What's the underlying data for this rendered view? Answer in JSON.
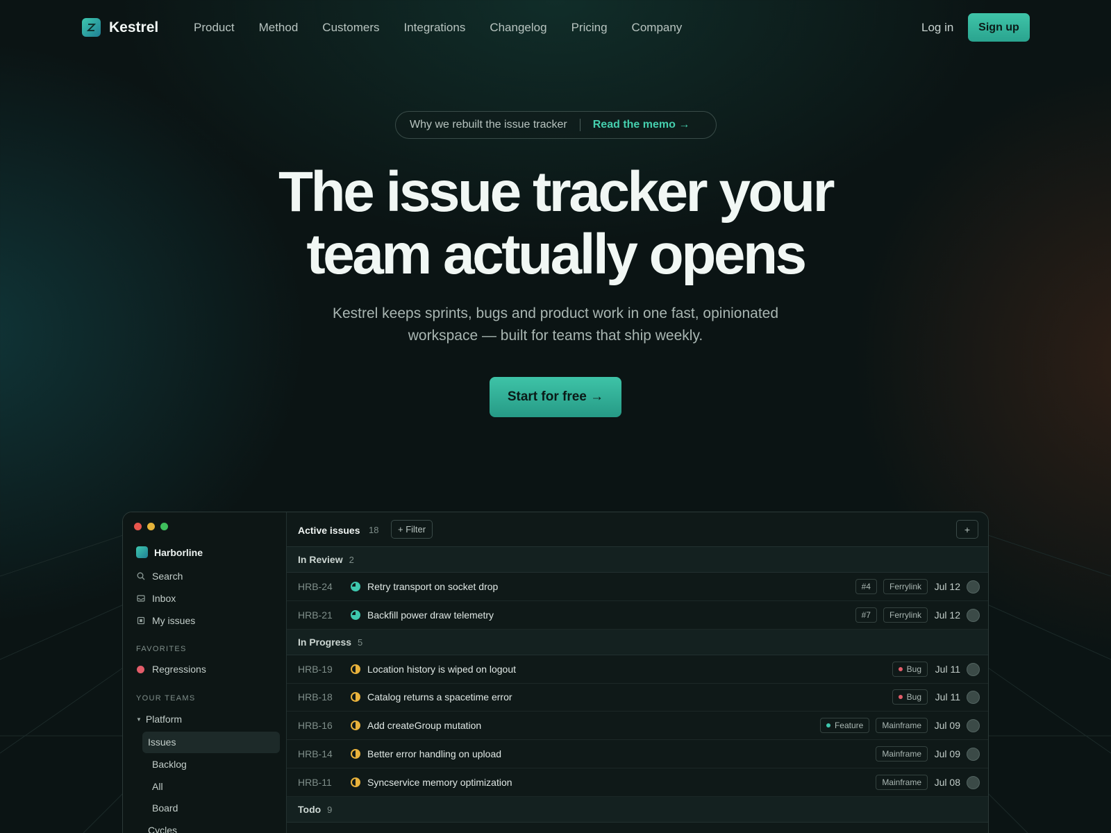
{
  "nav": {
    "brand": "Kestrel",
    "links": [
      "Product",
      "Method",
      "Customers",
      "Integrations",
      "Changelog",
      "Pricing",
      "Company"
    ],
    "login": "Log in",
    "signup": "Sign up"
  },
  "hero": {
    "pill_text": "Why we rebuilt the issue tracker",
    "pill_link": "Read the memo →",
    "headline_line1": "The issue tracker your",
    "headline_line2": "team actually opens",
    "sub_line1": "Kestrel keeps sprints, bugs and product work in one fast, opinionated",
    "sub_line2": "workspace — built for teams that ship weekly.",
    "cta": "Start for free →"
  },
  "colors": {
    "accent": "#3fc4a8",
    "review": "#3ec8ae",
    "progress": "#e9b23c",
    "bug": "#e35d6a",
    "feature": "#3ec8ae",
    "window_red": "#e8564d",
    "window_yellow": "#e5b33a",
    "window_green": "#3fbf5c"
  },
  "app": {
    "workspace": "Harborline",
    "sidebar": {
      "search": "Search",
      "inbox": "Inbox",
      "my_issues": "My issues",
      "favorites_head": "FAVORITES",
      "favorite": "Regressions",
      "teams_head": "YOUR TEAMS",
      "team": "Platform",
      "team_items": [
        "Issues",
        "Backlog",
        "All",
        "Board",
        "Cycles"
      ]
    },
    "topbar": {
      "title": "Active issues",
      "count": "18",
      "filter": "+ Filter",
      "add": "+"
    },
    "groups": [
      {
        "name": "In Review",
        "count": "2"
      },
      {
        "name": "In Progress",
        "count": "5"
      },
      {
        "name": "Todo",
        "count": "9"
      }
    ],
    "rows": [
      {
        "id": "HRB-24",
        "title": "Retry transport on socket drop",
        "tags": [
          "#4",
          "Ferrylink"
        ],
        "date": "Jul 12",
        "status": "review"
      },
      {
        "id": "HRB-21",
        "title": "Backfill power draw telemetry",
        "tags": [
          "#7",
          "Ferrylink"
        ],
        "date": "Jul 12",
        "status": "review"
      },
      {
        "id": "HRB-19",
        "title": "Location history is wiped on logout",
        "tags": [
          "Bug"
        ],
        "date": "Jul 11",
        "status": "progress"
      },
      {
        "id": "HRB-18",
        "title": "Catalog returns a spacetime error",
        "tags": [
          "Bug"
        ],
        "date": "Jul 11",
        "status": "progress"
      },
      {
        "id": "HRB-16",
        "title": "Add createGroup mutation",
        "tags": [
          "Feature",
          "Mainframe"
        ],
        "date": "Jul 09",
        "status": "progress"
      },
      {
        "id": "HRB-14",
        "title": "Better error handling on upload",
        "tags": [
          "Mainframe"
        ],
        "date": "Jul 09",
        "status": "progress"
      },
      {
        "id": "HRB-11",
        "title": "Syncservice memory optimization",
        "tags": [
          "Mainframe"
        ],
        "date": "Jul 08",
        "status": "progress"
      }
    ]
  }
}
